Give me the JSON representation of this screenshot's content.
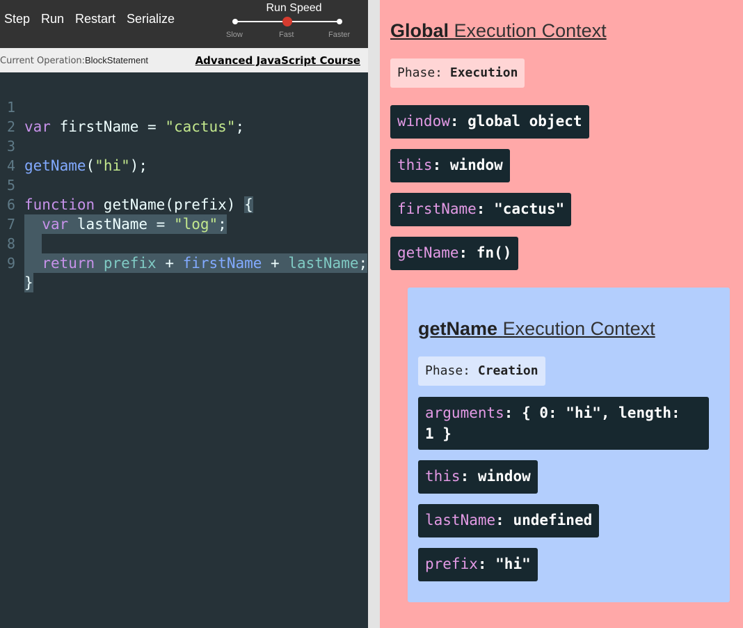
{
  "toolbar": {
    "step_label": "Step",
    "run_label": "Run",
    "restart_label": "Restart",
    "serialize_label": "Serialize",
    "speed": {
      "title": "Run Speed",
      "slow_label": "Slow",
      "fast_label": "Fast",
      "faster_label": "Faster",
      "selected": "Fast"
    }
  },
  "status": {
    "current_operation_label": "Current Operation:",
    "current_operation_value": "BlockStatement",
    "course_link": "Advanced JavaScript Course"
  },
  "editor": {
    "line_numbers": [
      "1",
      "2",
      "3",
      "4",
      "5",
      "6",
      "7",
      "8",
      "9"
    ],
    "highlighted_lines": [
      6,
      7,
      8,
      9
    ]
  },
  "global_context": {
    "title_bold": "Global",
    "title_rest": "Execution Context",
    "phase_label": "Phase:",
    "phase_value": "Execution",
    "variables": [
      {
        "name": "window",
        "value": "global object"
      },
      {
        "name": "this",
        "value": "window"
      },
      {
        "name": "firstName",
        "value": "\"cactus\""
      },
      {
        "name": "getName",
        "value": "fn()"
      }
    ]
  },
  "function_context": {
    "title_bold": "getName",
    "title_rest": "Execution Context",
    "phase_label": "Phase:",
    "phase_value": "Creation",
    "variables": [
      {
        "name": "arguments",
        "value": "{ 0: \"hi\", length:",
        "value_line2": "1 }"
      },
      {
        "name": "this",
        "value": "window"
      },
      {
        "name": "lastName",
        "value": "undefined"
      },
      {
        "name": "prefix",
        "value": "\"hi\""
      }
    ]
  },
  "colors": {
    "editor_bg": "#263238",
    "global_bg": "#ffa8a8",
    "function_bg": "#b3cefd",
    "var_box": "#17282f",
    "keyword": "#c792ea",
    "string": "#c3e88d",
    "function_name": "#82aaff",
    "slider_knob": "#d63b2f"
  }
}
